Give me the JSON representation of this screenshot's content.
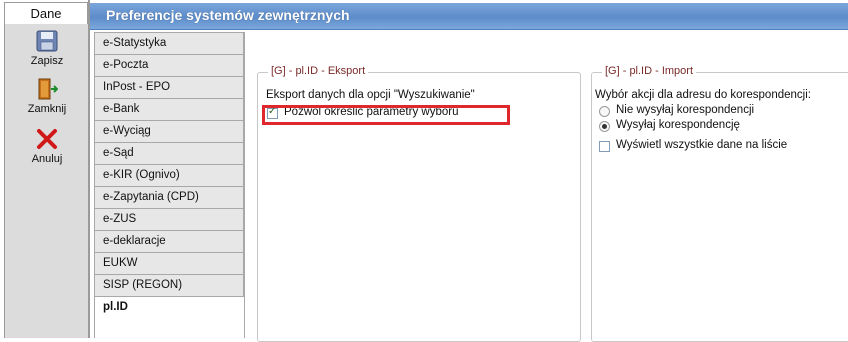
{
  "left": {
    "tab_label": "Dane",
    "tools": [
      {
        "label": "Zapisz",
        "icon": "save-icon"
      },
      {
        "label": "Zamknij",
        "icon": "exit-door-icon"
      },
      {
        "label": "Anuluj",
        "icon": "cancel-x-icon"
      }
    ]
  },
  "header": {
    "title": "Preferencje systemów zewnętrznych"
  },
  "nav": {
    "items": [
      {
        "label": "e-Statystyka"
      },
      {
        "label": "e-Poczta"
      },
      {
        "label": "InPost - EPO"
      },
      {
        "label": "e-Bank"
      },
      {
        "label": "e-Wyciąg"
      },
      {
        "label": "e-Sąd"
      },
      {
        "label": "e-KIR (Ognivo)"
      },
      {
        "label": "e-Zapytania (CPD)"
      },
      {
        "label": "e-ZUS"
      },
      {
        "label": "e-deklaracje"
      },
      {
        "label": "EUKW"
      },
      {
        "label": "SISP (REGON)"
      },
      {
        "label": "pl.ID"
      }
    ],
    "active": "pl.ID"
  },
  "export_group": {
    "legend": "[G] - pl.ID - Eksport",
    "text": "Eksport danych dla opcji \"Wyszukiwanie\"",
    "checkbox_label": "Pozwól określić parametry wyboru",
    "checked": true,
    "highlight_color": "#e0282c"
  },
  "import_group": {
    "legend": "[G] - pl.ID - Import",
    "text": "Wybór akcji dla adresu do korespondencji:",
    "radio_options": [
      {
        "label": "Nie wysyłaj korespondencji",
        "selected": false
      },
      {
        "label": "Wysyłaj korespondencję",
        "selected": true
      }
    ],
    "checkbox_label": "Wyświetl wszystkie dane na liście",
    "checked": false
  },
  "colors": {
    "header_blue": "#5d8cc9",
    "legend_text": "#7a2a2a",
    "cancel_red": "#d01818"
  }
}
